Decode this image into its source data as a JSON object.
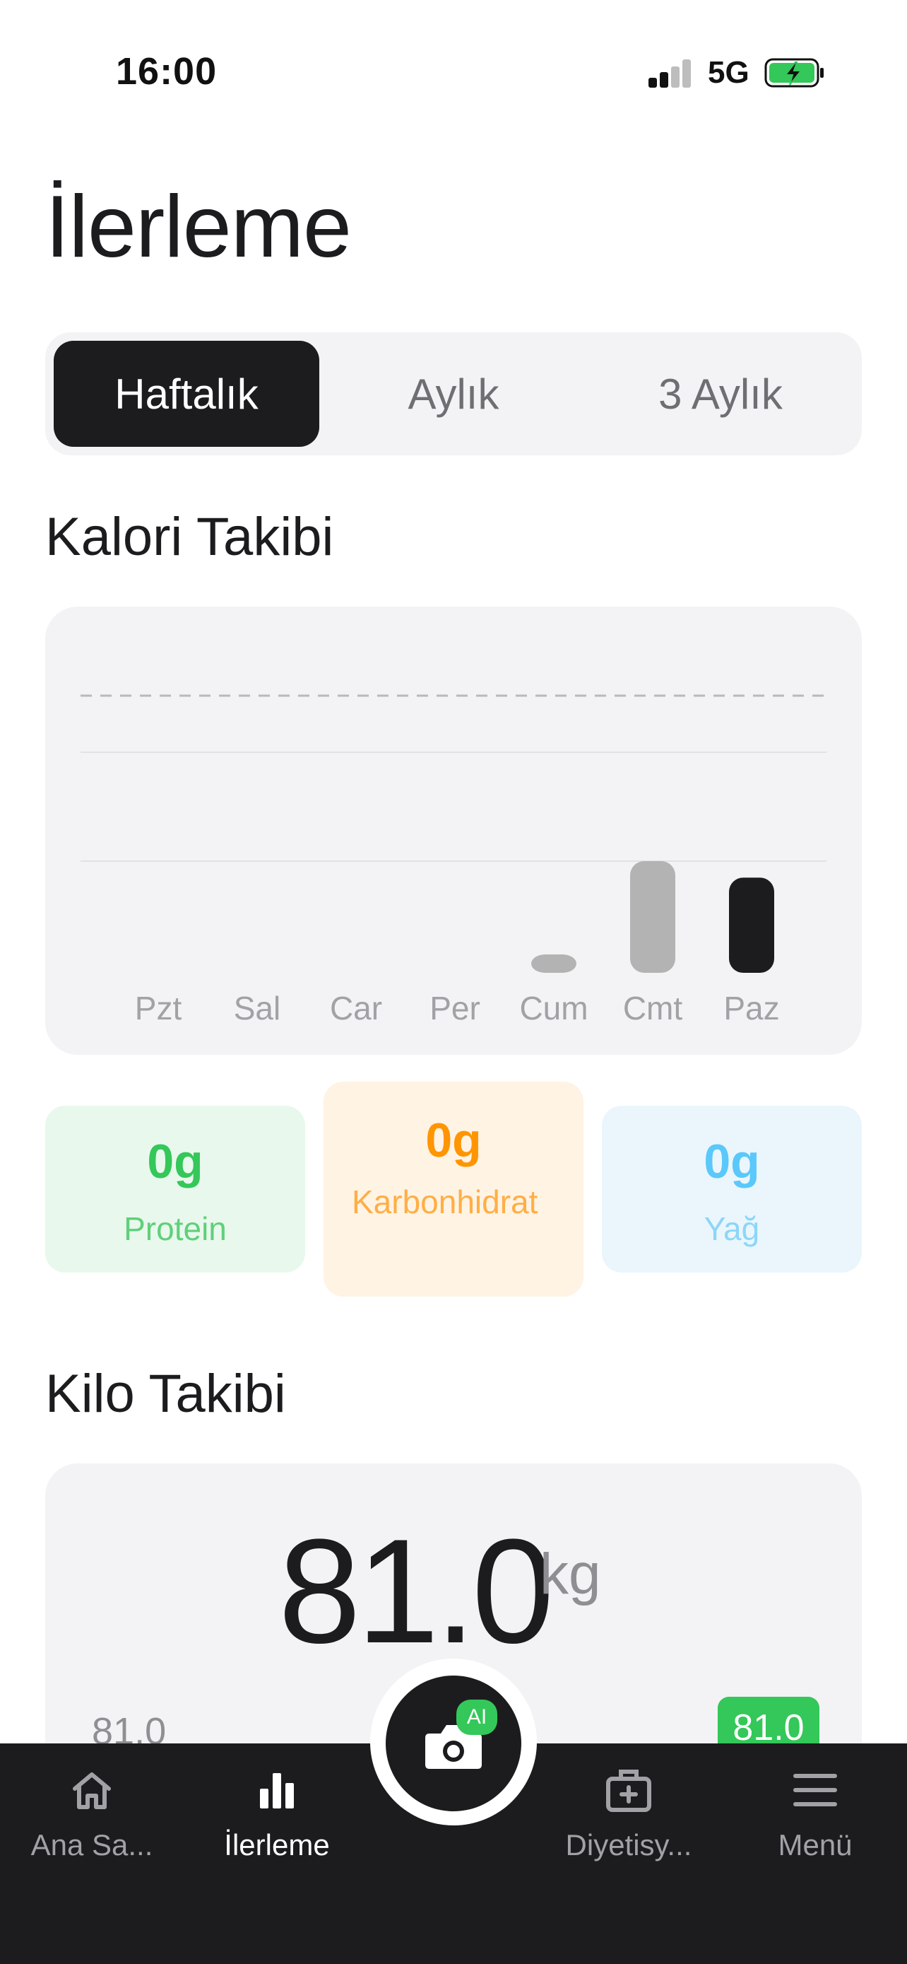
{
  "status_bar": {
    "time": "16:00",
    "network": "5G",
    "icons": [
      "signal-icon",
      "battery-charging-icon"
    ]
  },
  "page": {
    "title": "İlerleme"
  },
  "period_tabs": {
    "items": [
      "Haftalık",
      "Aylık",
      "3 Aylık"
    ],
    "selected": "Haftalık"
  },
  "calorie_section": {
    "title": "Kalori Takibi",
    "chart_data": {
      "type": "bar",
      "categories": [
        "Pzt",
        "Sal",
        "Car",
        "Per",
        "Cum",
        "Cmt",
        "Paz"
      ],
      "values": [
        0,
        0,
        0,
        0,
        0.14,
        1.0,
        0.85
      ],
      "highlight_index": 6,
      "dashed_reference_line": true,
      "grid": true,
      "colors": {
        "bar": "#b3b3b3",
        "bar_highlight": "#1c1c1e"
      }
    }
  },
  "macros": {
    "protein": {
      "value": "0g",
      "label": "Protein",
      "color": "#34c759"
    },
    "carb": {
      "value": "0g",
      "label": "Karbonhidrat",
      "color": "#ff9500"
    },
    "fat": {
      "value": "0g",
      "label": "Yağ",
      "color": "#5ac8fa"
    }
  },
  "weight_section": {
    "title": "Kilo Takibi",
    "current": "81.0",
    "unit": "kg",
    "min_label": "81.0",
    "badge": "81.0"
  },
  "tab_bar": {
    "items": [
      {
        "label": "Ana Sa...",
        "icon": "home-icon"
      },
      {
        "label": "İlerleme",
        "icon": "bar-chart-icon"
      },
      {
        "label": "Diyetisy...",
        "icon": "medical-kit-icon"
      },
      {
        "label": "Menü",
        "icon": "menu-icon"
      }
    ],
    "active": "İlerleme",
    "camera": {
      "icon": "camera-icon",
      "badge": "AI"
    }
  }
}
